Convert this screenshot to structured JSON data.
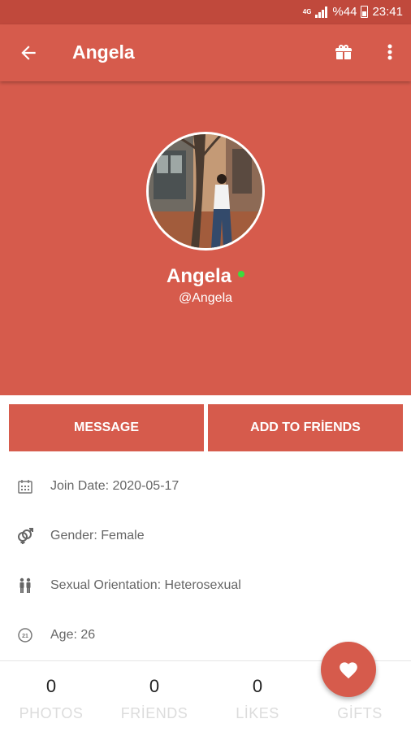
{
  "status_bar": {
    "network": "4G",
    "battery_text": "%44",
    "time": "23:41"
  },
  "toolbar": {
    "title": "Angela"
  },
  "profile": {
    "name": "Angela",
    "handle": "@Angela"
  },
  "actions": {
    "message_label": "MESSAGE",
    "add_friend_label": "ADD TO FRİENDS"
  },
  "info": {
    "join_date": "Join Date: 2020-05-17",
    "gender": "Gender: Female",
    "orientation": "Sexual Orientation: Heterosexual",
    "age": "Age: 26"
  },
  "stats": [
    {
      "count": "0",
      "label": "PHOTOS"
    },
    {
      "count": "0",
      "label": "FRİENDS"
    },
    {
      "count": "0",
      "label": "LİKES"
    },
    {
      "count": "",
      "label": "GİFTS"
    }
  ],
  "colors": {
    "primary": "#d65b4c",
    "status_bar": "#c0493c",
    "online": "#3ddc3d"
  },
  "icons": [
    "back-arrow-icon",
    "gift-icon",
    "more-vert-icon",
    "calendar-icon",
    "gender-icon",
    "orientation-icon",
    "age-icon",
    "heart-icon"
  ]
}
